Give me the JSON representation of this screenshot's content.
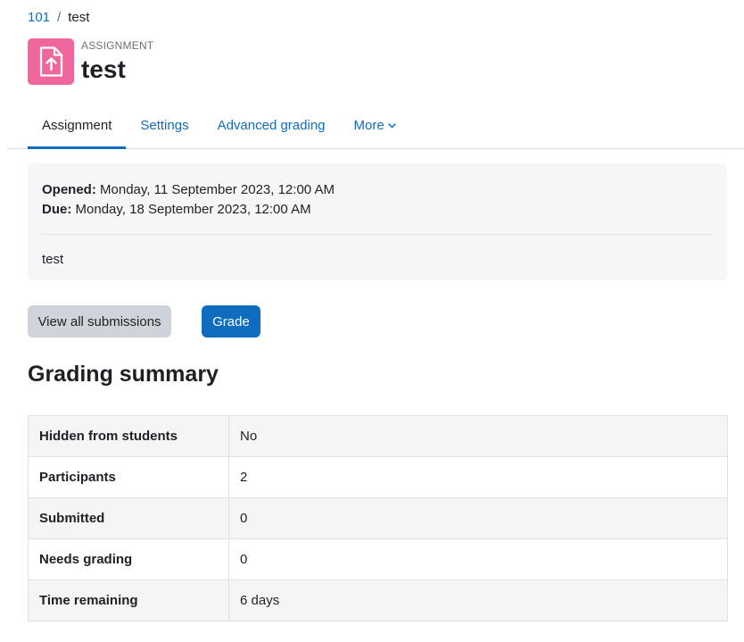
{
  "breadcrumb": {
    "course": "101",
    "separator": "/",
    "current": "test"
  },
  "header": {
    "module_type": "ASSIGNMENT",
    "title": "test",
    "icon": "assignment-upload-icon",
    "icon_bg": "#f0679e"
  },
  "tabs": [
    {
      "label": "Assignment",
      "active": true
    },
    {
      "label": "Settings"
    },
    {
      "label": "Advanced grading"
    },
    {
      "label": "More"
    }
  ],
  "dates": {
    "opened_label": "Opened:",
    "opened_value": "Monday, 11 September 2023, 12:00 AM",
    "due_label": "Due:",
    "due_value": "Monday, 18 September 2023, 12:00 AM"
  },
  "intro": "test",
  "buttons": {
    "view_all": "View all submissions",
    "grade": "Grade"
  },
  "grading_summary": {
    "title": "Grading summary",
    "rows": [
      {
        "label": "Hidden from students",
        "value": "No"
      },
      {
        "label": "Participants",
        "value": "2"
      },
      {
        "label": "Submitted",
        "value": "0"
      },
      {
        "label": "Needs grading",
        "value": "0"
      },
      {
        "label": "Time remaining",
        "value": "6 days"
      }
    ]
  },
  "colors": {
    "link": "#0f6cbf",
    "primary_button": "#0f6cbf",
    "secondary_button": "#ced4da"
  }
}
